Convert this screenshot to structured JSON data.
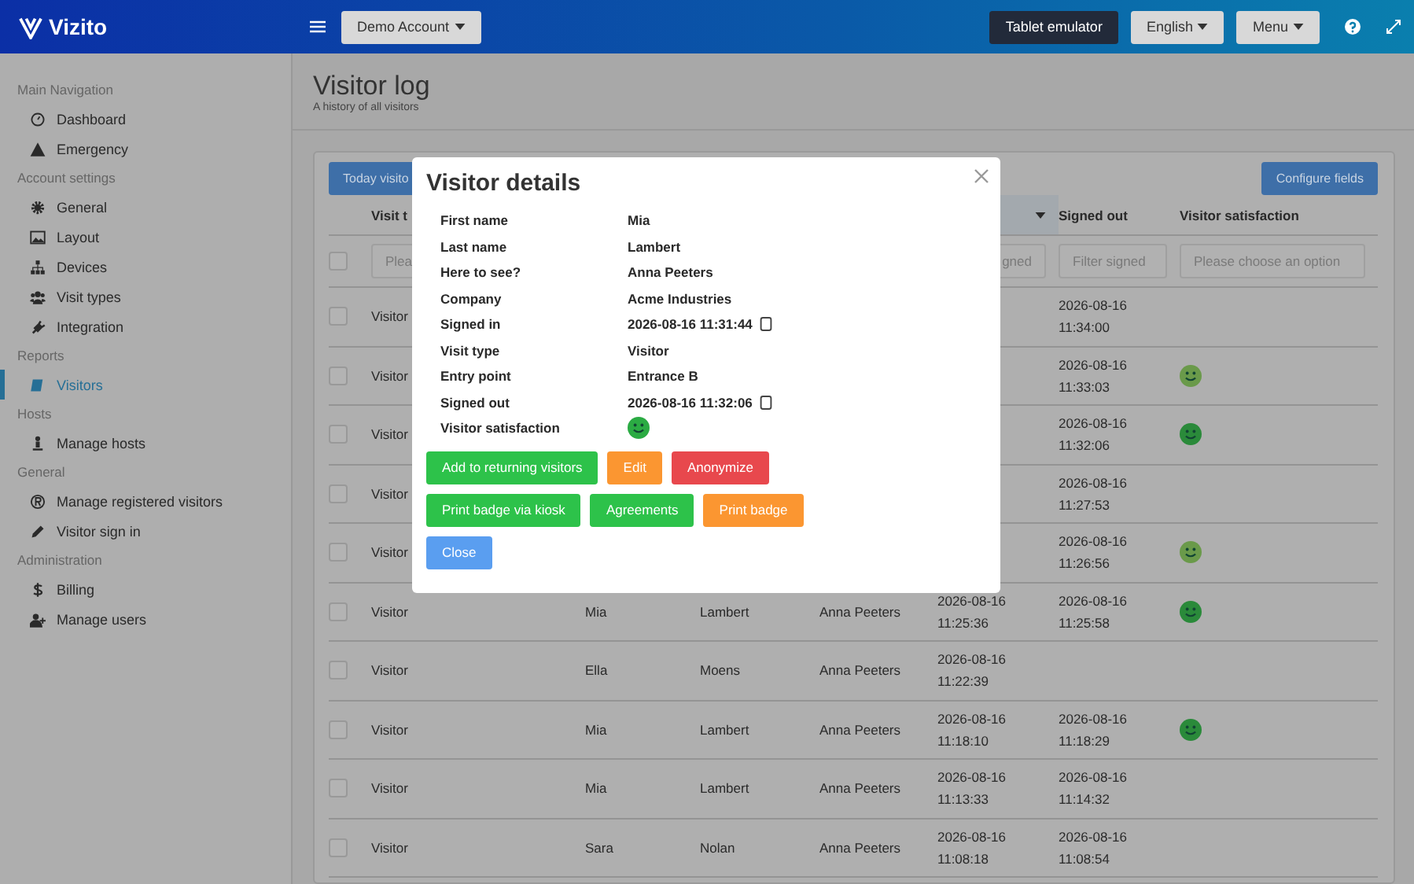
{
  "topbar": {
    "brand": "Vizito",
    "account": "Demo Account",
    "buttons": [
      {
        "label": "Tablet emulator",
        "kind": "dark"
      },
      {
        "label": "English",
        "kind": "dropdown"
      },
      {
        "label": "Menu",
        "kind": "dropdown"
      }
    ]
  },
  "sidebar": {
    "sections": [
      {
        "title": "Main Navigation",
        "items": [
          {
            "label": "Dashboard",
            "selected": false
          },
          {
            "label": "Emergency",
            "selected": false
          }
        ]
      },
      {
        "title": "Account settings",
        "items": [
          {
            "label": "General",
            "selected": false
          },
          {
            "label": "Layout",
            "selected": false
          },
          {
            "label": "Devices",
            "selected": false
          },
          {
            "label": "Visit types",
            "selected": false
          },
          {
            "label": "Integration",
            "selected": false
          }
        ]
      },
      {
        "title": "Reports",
        "items": [
          {
            "label": "Visitors",
            "selected": true
          }
        ]
      },
      {
        "title": "Hosts",
        "items": [
          {
            "label": "Manage hosts",
            "selected": false
          }
        ]
      },
      {
        "title": "General",
        "items": [
          {
            "label": "Manage registered visitors",
            "selected": false
          },
          {
            "label": "Visitor sign in",
            "selected": false
          }
        ]
      },
      {
        "title": "Administration",
        "items": [
          {
            "label": "Billing",
            "selected": false
          },
          {
            "label": "Manage users",
            "selected": false
          }
        ]
      }
    ]
  },
  "page": {
    "title": "Visitor log",
    "subtitle": "A history of all visitors"
  },
  "table": {
    "today_button": "Today visito",
    "configure_button": "Configure fields",
    "select_all_checked": false,
    "columns": [
      {
        "label": "Visit t",
        "sorted": false
      },
      {
        "sorted": true
      },
      {
        "label": "Signed out",
        "sorted": false
      },
      {
        "label": "Visitor satisfaction",
        "sorted": false
      }
    ],
    "filters": [
      {
        "placeholder": "Plea"
      },
      {
        "placeholder": "gned"
      },
      {
        "placeholder": "Filter signed"
      },
      {
        "placeholder": "Please choose an option"
      }
    ],
    "rows": [
      {
        "checked": false,
        "visit_type": "Visitor",
        "signed_out": [
          "2026-08-16",
          "11:34:00"
        ]
      },
      {
        "checked": false,
        "visit_type": "Visitor",
        "signed_out": [
          "2026-08-16",
          "11:33:03"
        ],
        "satisfaction": {
          "color": "#6a9a4a"
        }
      },
      {
        "checked": false,
        "visit_type": "Visitor",
        "signed_out": [
          "2026-08-16",
          "11:32:06"
        ],
        "satisfaction": {
          "color": "#2a8a3a"
        }
      },
      {
        "checked": false,
        "visit_type": "Visitor",
        "signed_out": [
          "2026-08-16",
          "11:27:53"
        ]
      },
      {
        "checked": false,
        "visit_type": "Visitor",
        "signed_out": [
          "2026-08-16",
          "11:26:56"
        ],
        "satisfaction": {
          "color": "#6a9a4a"
        }
      },
      {
        "checked": false,
        "visit_type": "Visitor",
        "first_name": "Mia",
        "last_name": "Lambert",
        "host": "Anna Peeters",
        "signed_in": [
          "2026-08-16",
          "11:25:36"
        ],
        "signed_out": [
          "2026-08-16",
          "11:25:58"
        ],
        "satisfaction": {
          "color": "#2a8a3a"
        }
      },
      {
        "checked": false,
        "visit_type": "Visitor",
        "first_name": "Ella",
        "last_name": "Moens",
        "host": "Anna Peeters",
        "signed_in": [
          "2026-08-16",
          "11:22:39"
        ]
      },
      {
        "checked": false,
        "visit_type": "Visitor",
        "first_name": "Mia",
        "last_name": "Lambert",
        "host": "Anna Peeters",
        "signed_in": [
          "2026-08-16",
          "11:18:10"
        ],
        "signed_out": [
          "2026-08-16",
          "11:18:29"
        ],
        "satisfaction": {
          "color": "#2a8a3a"
        }
      },
      {
        "checked": false,
        "visit_type": "Visitor",
        "first_name": "Mia",
        "last_name": "Lambert",
        "host": "Anna Peeters",
        "signed_in": [
          "2026-08-16",
          "11:13:33"
        ],
        "signed_out": [
          "2026-08-16",
          "11:14:32"
        ]
      },
      {
        "checked": false,
        "visit_type": "Visitor",
        "first_name": "Sara",
        "last_name": "Nolan",
        "host": "Anna Peeters",
        "signed_in": [
          "2026-08-16",
          "11:08:18"
        ],
        "signed_out": [
          "2026-08-16",
          "11:08:54"
        ]
      }
    ]
  },
  "modal": {
    "title": "Visitor details",
    "fields": [
      {
        "label": "First name",
        "value": "Mia",
        "kind": "text"
      },
      {
        "label": "Last name",
        "value": "Lambert",
        "kind": "text"
      },
      {
        "label": "Here to see?",
        "value": "Anna Peeters",
        "kind": "text"
      },
      {
        "label": "Company",
        "value": "Acme Industries",
        "kind": "text"
      },
      {
        "label": "Signed in",
        "value": "2026-08-16 11:31:44",
        "kind": "device-time"
      },
      {
        "label": "Visit type",
        "value": "Visitor",
        "kind": "text"
      },
      {
        "label": "Entry point",
        "value": "Entrance B",
        "kind": "text"
      },
      {
        "label": "Signed out",
        "value": "2026-08-16 11:32:06",
        "kind": "device-time"
      },
      {
        "label": "Visitor satisfaction",
        "color": "#2bab43",
        "kind": "satisfaction"
      }
    ],
    "button_rows": [
      [
        {
          "label": "Add to returning visitors",
          "kind": "success"
        },
        {
          "label": "Edit",
          "kind": "warning"
        },
        {
          "label": "Anonymize",
          "kind": "danger"
        }
      ],
      [
        {
          "label": "Print badge via kiosk",
          "kind": "success"
        },
        {
          "label": "Agreements",
          "kind": "success"
        },
        {
          "label": "Print badge",
          "kind": "warning"
        }
      ],
      [
        {
          "label": "Close",
          "kind": "primary"
        }
      ]
    ]
  }
}
